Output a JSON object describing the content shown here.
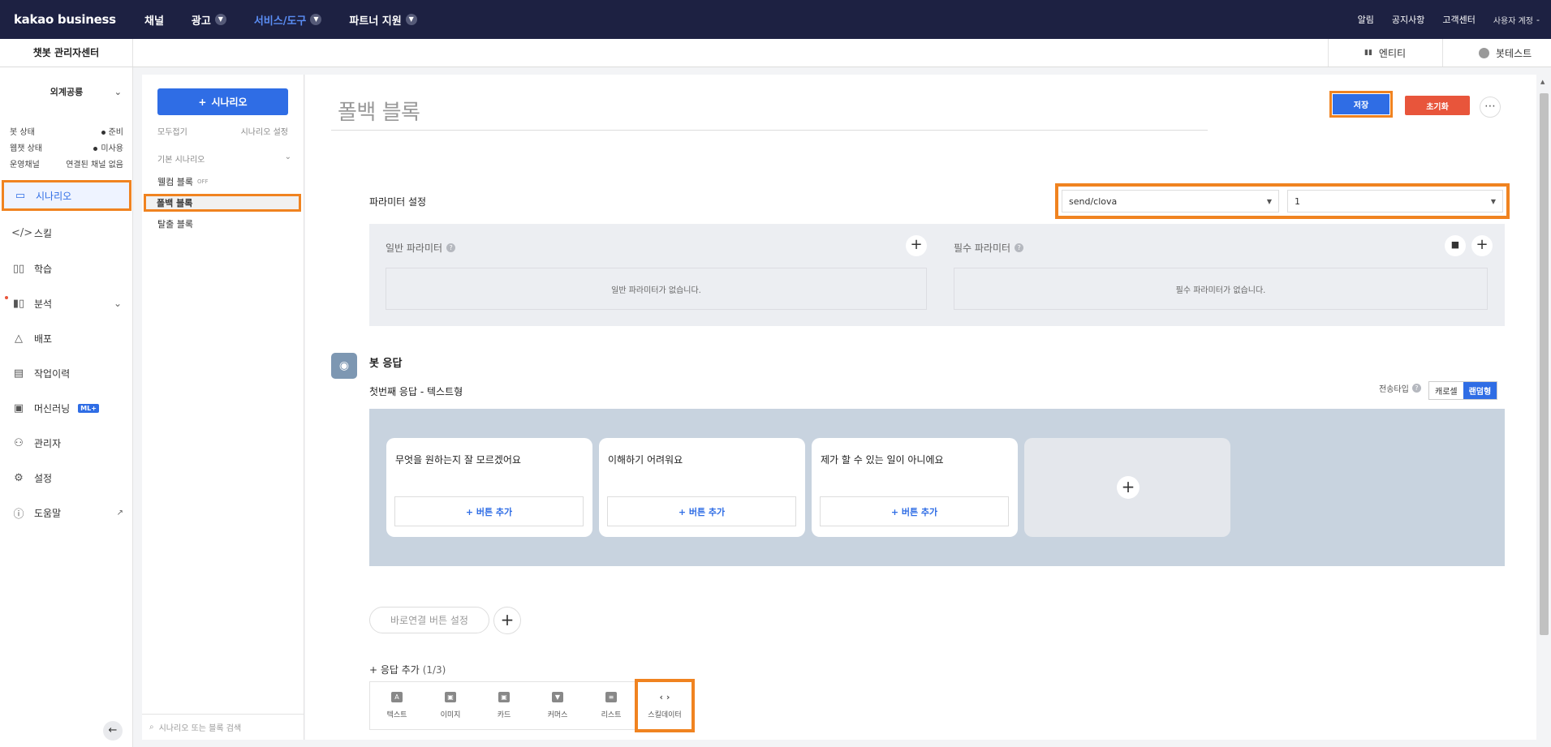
{
  "topnav": {
    "logo": "kakao business",
    "items": [
      {
        "label": "채널"
      },
      {
        "label": "광고"
      },
      {
        "label": "서비스/도구"
      },
      {
        "label": "파트너 지원"
      }
    ],
    "right": {
      "alerts": "알림",
      "notices": "공지사항",
      "support": "고객센터",
      "account": "사용자 계정"
    }
  },
  "subheader": {
    "title": "챗봇 관리자센터",
    "entity": "엔티티",
    "bottest": "봇테스트"
  },
  "sidebar": {
    "bot_name": "외계공룡",
    "status": [
      {
        "label": "봇 상태",
        "value": "준비"
      },
      {
        "label": "웹챗 상태",
        "value": "미사용"
      },
      {
        "label": "운영채널",
        "value": "연결된 채널 없음"
      }
    ],
    "menu": [
      {
        "label": "시나리오",
        "icon": "scenario-icon"
      },
      {
        "label": "스킬",
        "icon": "code-icon"
      },
      {
        "label": "학습",
        "icon": "book-icon"
      },
      {
        "label": "분석",
        "icon": "chart-icon"
      },
      {
        "label": "배포",
        "icon": "deploy-icon"
      },
      {
        "label": "작업이력",
        "icon": "history-icon"
      },
      {
        "label": "머신러닝",
        "icon": "ml-icon",
        "badge": "ML+"
      },
      {
        "label": "관리자",
        "icon": "user-icon"
      },
      {
        "label": "설정",
        "icon": "gear-icon"
      },
      {
        "label": "도움말",
        "icon": "help-icon"
      }
    ]
  },
  "scenario_panel": {
    "add_label": "시나리오",
    "collapse_all": "모두접기",
    "scenario_settings": "시나리오 설정",
    "group": "기본 시나리오",
    "items": [
      {
        "label": "웰컴 블록",
        "tag": "OFF"
      },
      {
        "label": "폴백 블록"
      },
      {
        "label": "탈출 블록"
      }
    ],
    "search_placeholder": "시나리오 또는 블록 검색"
  },
  "main": {
    "title": "폴백 블록",
    "save": "저장",
    "reset": "초기화",
    "param_label": "파라미터 설정",
    "skill_select": "send/clova",
    "version_select": "1",
    "general_params": "일반 파라미터",
    "general_empty": "일반 파라미터가 없습니다.",
    "required_params": "필수 파라미터",
    "required_empty": "필수 파라미터가 없습니다.",
    "bot_response": "봇 응답",
    "first_response": "첫번째 응답 - 텍스트형",
    "send_type": "전송타입",
    "toggle_carousel": "캐로셀",
    "toggle_random": "랜덤형",
    "cards": [
      {
        "text": "무엇을 원하는지 잘 모르겠어요",
        "button": "+ 버튼 추가"
      },
      {
        "text": "이해하기 어려워요",
        "button": "+ 버튼 추가"
      },
      {
        "text": "제가 할 수 있는 일이 아니에요",
        "button": "+ 버튼 추가"
      }
    ],
    "quick_reply": "바로연결 버튼 설정",
    "response_add": "+ 응답 추가",
    "response_count": "(1/3)",
    "response_types": [
      {
        "label": "텍스트",
        "glyph": "A"
      },
      {
        "label": "이미지",
        "glyph": "▣"
      },
      {
        "label": "카드",
        "glyph": "▣"
      },
      {
        "label": "커머스",
        "glyph": "▼"
      },
      {
        "label": "리스트",
        "glyph": "≡"
      },
      {
        "label": "스킬데이터",
        "glyph": "‹ ›"
      }
    ]
  }
}
